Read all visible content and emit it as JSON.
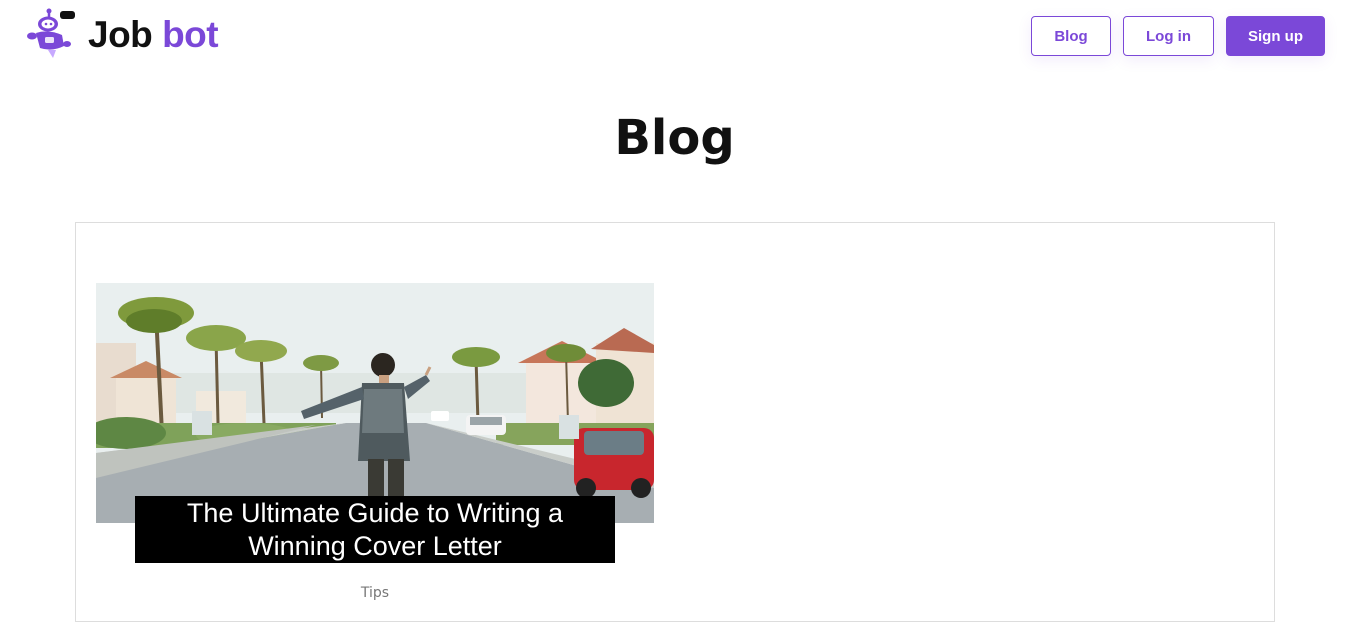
{
  "brand": {
    "name_part1": "Job",
    "name_part2": "bot"
  },
  "nav": {
    "blog_label": "Blog",
    "login_label": "Log in",
    "signup_label": "Sign up"
  },
  "page": {
    "title": "Blog"
  },
  "posts": [
    {
      "title": "The Ultimate Guide to Writing a Winning Cover Letter",
      "category": "Tips"
    }
  ],
  "colors": {
    "brand_purple": "#7b48d8",
    "text_dark": "#111111"
  }
}
